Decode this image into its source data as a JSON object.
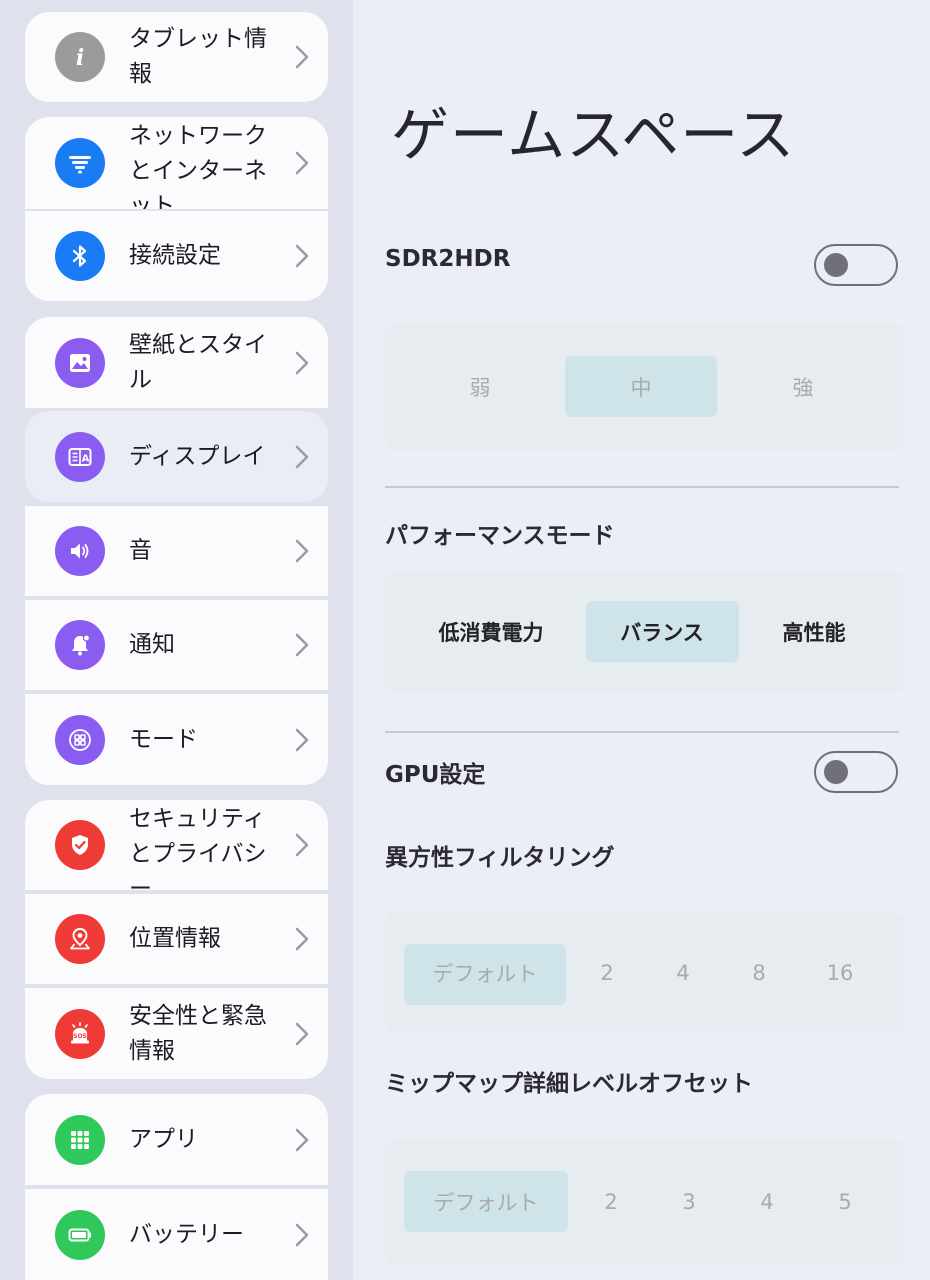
{
  "sidebar": {
    "items": [
      {
        "label": "タブレット情報",
        "icon": "info-icon"
      },
      {
        "label": "ネットワークとインターネット",
        "icon": "wifi-icon"
      },
      {
        "label": "接続設定",
        "icon": "bluetooth-icon"
      },
      {
        "label": "壁紙とスタイル",
        "icon": "image-icon"
      },
      {
        "label": "ディスプレイ",
        "icon": "display-icon"
      },
      {
        "label": "音",
        "icon": "speaker-icon"
      },
      {
        "label": "通知",
        "icon": "bell-icon"
      },
      {
        "label": "モード",
        "icon": "mode-grid-icon"
      },
      {
        "label": "セキュリティとプライバシー",
        "icon": "shield-icon"
      },
      {
        "label": "位置情報",
        "icon": "location-pin-icon"
      },
      {
        "label": "安全性と緊急情報",
        "icon": "sos-icon"
      },
      {
        "label": "アプリ",
        "icon": "apps-grid-icon"
      },
      {
        "label": "バッテリー",
        "icon": "battery-icon"
      }
    ]
  },
  "main": {
    "title": "ゲームスペース",
    "sdr2hdr": {
      "label": "SDR2HDR",
      "enabled": false,
      "options": [
        "弱",
        "中",
        "強"
      ],
      "selected": "中"
    },
    "performance": {
      "label": "パフォーマンスモード",
      "options": [
        "低消費電力",
        "バランス",
        "高性能"
      ],
      "selected": "バランス"
    },
    "gpu": {
      "label": "GPU設定",
      "enabled": false
    },
    "anisotropic": {
      "label": "異方性フィルタリング",
      "options": [
        "デフォルト",
        "2",
        "4",
        "8",
        "16"
      ],
      "selected": "デフォルト"
    },
    "mipmap": {
      "label": "ミップマップ詳細レベルオフセット",
      "options": [
        "デフォルト",
        "2",
        "3",
        "4",
        "5"
      ],
      "selected": "デフォルト"
    }
  },
  "colors": {
    "info": "#9b9b9b",
    "network": "#1a7cf2",
    "bluetooth": "#1a7cf2",
    "purple": "#8b5cf0",
    "red": "#ef3b35",
    "green": "#2ec95a"
  }
}
